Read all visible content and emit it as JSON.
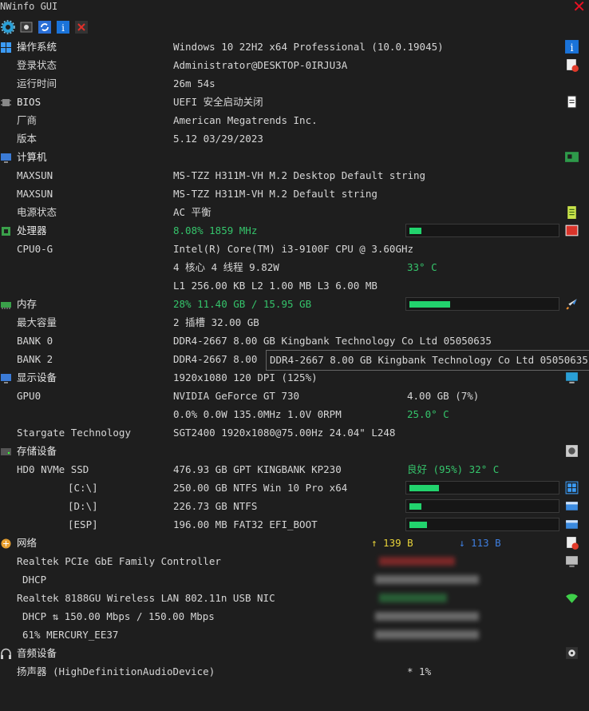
{
  "window": {
    "title": "NWinfo GUI"
  },
  "toolbar": {
    "buttons": [
      "settings-icon",
      "screenshot-icon",
      "refresh-icon",
      "info-icon",
      "close-icon"
    ]
  },
  "os": {
    "label": "操作系统",
    "value": "Windows 10 22H2 x64 Professional (10.0.19045)",
    "login_label": "登录状态",
    "login_value": "Administrator@DESKTOP-0IRJU3A",
    "uptime_label": "运行时间",
    "uptime_value": "26m 54s"
  },
  "bios": {
    "label": "BIOS",
    "value": "UEFI 安全启动关闭",
    "vendor_label": "厂商",
    "vendor_value": "American Megatrends Inc.",
    "version_label": "版本",
    "version_value": "5.12 03/29/2023"
  },
  "computer": {
    "label": "计算机",
    "sys_label": "MAXSUN",
    "sys_value": "MS-TZZ H311M-VH M.2 Desktop Default string",
    "board_label": "MAXSUN",
    "board_value": "MS-TZZ H311M-VH M.2 Default string",
    "power_label": "电源状态",
    "power_value": "AC  平衡"
  },
  "cpu": {
    "label": "处理器",
    "usage": "8.08% 1859 MHz",
    "usage_fraction": 0.0808,
    "name_label": "CPU0-G",
    "name_value": "Intel(R) Core(TM) i3-9100F CPU @ 3.60GHz",
    "cores_value": "4 核心 4 线程 9.82W",
    "temp": "33° C",
    "cache_value": "L1 256.00 KB L2 1.00 MB L3 6.00 MB"
  },
  "memory": {
    "label": "内存",
    "usage": "28% 11.40 GB / 15.95 GB",
    "usage_fraction": 0.28,
    "max_label": "最大容量",
    "max_value": "2 插槽 32.00 GB",
    "bank0_label": "BANK 0",
    "bank0_value": "DDR4-2667 8.00 GB Kingbank Technology Co Ltd 05050635",
    "bank2_label": "BANK 2",
    "bank2_value": "DDR4-2667 8.00",
    "tooltip": "DDR4-2667 8.00 GB Kingbank Technology Co Ltd 05050635"
  },
  "display": {
    "label": "显示设备",
    "value": "1920x1080 120 DPI (125%)",
    "gpu_label": "GPU0",
    "gpu_value": "NVIDIA GeForce GT 730",
    "gpu_mem": "4.00 GB (7%)",
    "gpu_stats": "0.0% 0.0W 135.0MHz 1.0V 0RPM",
    "gpu_temp": "25.0° C",
    "monitor_label": "Stargate Technology",
    "monitor_value": "SGT2400 1920x1080@75.00Hz 24.04\" L248"
  },
  "storage": {
    "label": "存储设备",
    "disk_label": "HD0 NVMe SSD",
    "disk_value": "476.93 GB GPT KINGBANK KP230",
    "disk_health": "良好 (95%) 32° C",
    "c_label": "[C:\\]",
    "c_value": "250.00 GB NTFS Win 10 Pro x64",
    "c_fraction": 0.2,
    "d_label": "[D:\\]",
    "d_value": "226.73 GB NTFS",
    "d_fraction": 0.08,
    "esp_label": "[ESP]",
    "esp_value": "196.00 MB FAT32 EFI_BOOT",
    "esp_fraction": 0.12
  },
  "network": {
    "label": "网络",
    "up": "↑ 139 B",
    "down": "↓ 113 B",
    "nic1_label": "Realtek PCIe GbE Family Controller",
    "nic1_sub_label": "DHCP",
    "nic2_label": "Realtek 8188GU Wireless LAN 802.11n USB NIC",
    "nic2_sub_label": "DHCP ⇅ 150.00 Mbps / 150.00 Mbps",
    "nic2_ssid": "61% MERCURY_EE37"
  },
  "audio": {
    "label": "音频设备",
    "speaker_label": "扬声器 (HighDefinitionAudioDevice)",
    "speaker_value": "* 1%"
  },
  "colors": {
    "background": "#1e1e1e",
    "accent_green": "#22d36d",
    "text": "#d6d6d6",
    "close_red": "#e81123"
  }
}
